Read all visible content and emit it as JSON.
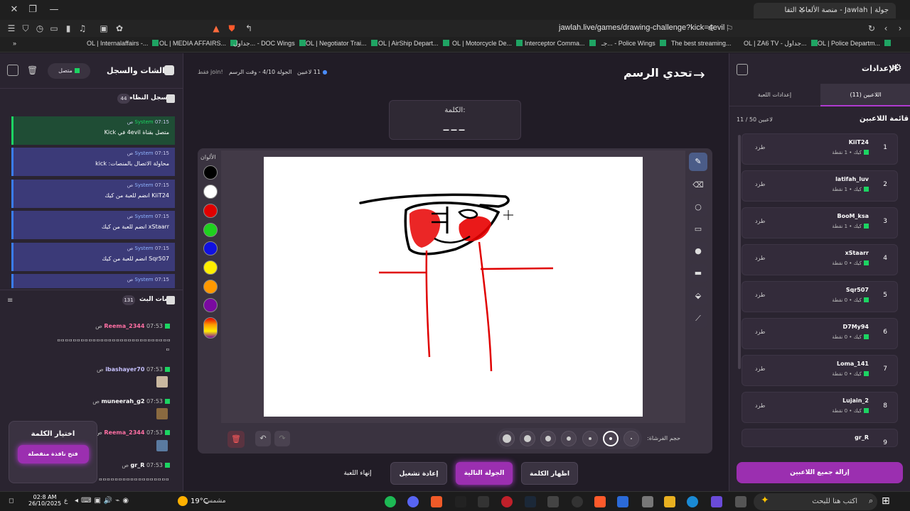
{
  "browser": {
    "tab_title": "جولة | Jawlah - منصة الألعاب التفا",
    "url": "jawlah.live/games/drawing-challenge?kick=4evil"
  },
  "bookmarks": [
    "OL | Internalaffairs -...",
    "OL | MEDIA AFFAIRS...",
    "جداول... - DOC Wings",
    "OL | Negotiator Trai...",
    "OL | AirShip Depart...",
    "OL | Motorcycle De...",
    "Interceptor Comma...",
    "جـ... - Police Wings",
    "The best streaming...",
    "OL | ZA6 TV - جداول...",
    "OL | Police Departm..."
  ],
  "header": {
    "title": "تحدي الرسم",
    "players_count": "11 لاعبين",
    "round": "الجولة 4/10 - وقت الرسم",
    "join": "!join فقط"
  },
  "word": {
    "label": "الكلمة:",
    "value": "___"
  },
  "left": {
    "title": "الشات والسجل",
    "status": "متصل",
    "syslog": "سجل النظام",
    "syslog_count": "44",
    "botchat": "شات البث",
    "botchat_count": "131",
    "messages": [
      {
        "user": "System",
        "time": "07:15 ص",
        "text": "متصل بقناة 4evil في Kick"
      },
      {
        "user": "System",
        "time": "07:15 ص",
        "text": "محاولة الاتصال بالمنصات: kick"
      },
      {
        "user": "System",
        "time": "07:15 ص",
        "text": "KiiT24 انضم للعبة من كيك"
      },
      {
        "user": "System",
        "time": "07:15 ص",
        "text": "xStaarr انضم للعبة من كيك"
      },
      {
        "user": "System",
        "time": "07:15 ص",
        "text": "Sqr507 انضم للعبة من كيك"
      },
      {
        "user": "System",
        "time": "07:15 ص",
        "text": ""
      }
    ],
    "chat": [
      {
        "user": "Reema_2344",
        "time": "07:53 ص",
        "text": "ㅁㅁㅁㅁㅁㅁㅁㅁㅁㅁㅁㅁㅁㅁㅁㅁㅁㅁㅁㅁㅁㅁㅁㅁㅁㅁㅁㅁㅁ",
        "text2": "ㅁ"
      },
      {
        "user": "ibashayer70",
        "time": "07:53 ص",
        "text": ""
      },
      {
        "user": "muneerah_g2",
        "time": "07:53 ص",
        "text": ""
      },
      {
        "user": "Reema_2344",
        "time": "07:53 ص",
        "text": ""
      },
      {
        "user": "gr_R",
        "time": "07:53 ص",
        "text": "ㅁㅁㅁㅁㅁㅁㅁㅁㅁㅁㅁㅁㅁㅁㅁㅁㅁㅁㅁ"
      }
    ],
    "choose_word": "اختيار الكلمة",
    "open_window": "فتح نافذة منفصلة"
  },
  "right": {
    "settings": "الإعدادات",
    "tab_players": "اللاعبين (11)",
    "tab_game": "إعدادات اللعبة",
    "list_title": "قائمة اللاعبين",
    "list_count": "11 / 50 لاعبين",
    "kick_label": "طرد",
    "remove_all": "إزالة جميع اللاعبين",
    "players": [
      {
        "rank": "1",
        "name": "KiiT24",
        "sub": "كيك • 1 نقطة"
      },
      {
        "rank": "2",
        "name": "latifah_luv",
        "sub": "كيك • 1 نقطة"
      },
      {
        "rank": "3",
        "name": "BooM_ksa",
        "sub": "كيك • 1 نقطة"
      },
      {
        "rank": "4",
        "name": "xStaarr",
        "sub": "كيك • 0 نقطة"
      },
      {
        "rank": "5",
        "name": "Sqr507",
        "sub": "كيك • 0 نقطة"
      },
      {
        "rank": "6",
        "name": "D7My94",
        "sub": "كيك • 0 نقطة"
      },
      {
        "rank": "7",
        "name": "Loma_141",
        "sub": "كيك • 0 نقطة"
      },
      {
        "rank": "8",
        "name": "Lujain_2",
        "sub": "كيك • 0 نقطة"
      },
      {
        "rank": "9",
        "name": "gr_R",
        "sub": ""
      }
    ]
  },
  "canvas": {
    "colors_label": "الألوان",
    "brush_label": "حجم الفرشاة:",
    "colors": [
      "#000000",
      "#ffffff",
      "#e00000",
      "#1fd11f",
      "#1010e0",
      "#ffee00",
      "#ff9800",
      "#7a0aa0"
    ]
  },
  "buttons": {
    "end": "إنهاء اللعبة",
    "restart": "إعادة تشغيل",
    "next": "الجولة التالية",
    "show": "اظهار الكلمة"
  },
  "taskbar": {
    "search": "اكتب هنا للبحث",
    "weather": "مشمس",
    "temp": "19°C",
    "time": "02:8 AM",
    "date": "26/10/2025"
  }
}
